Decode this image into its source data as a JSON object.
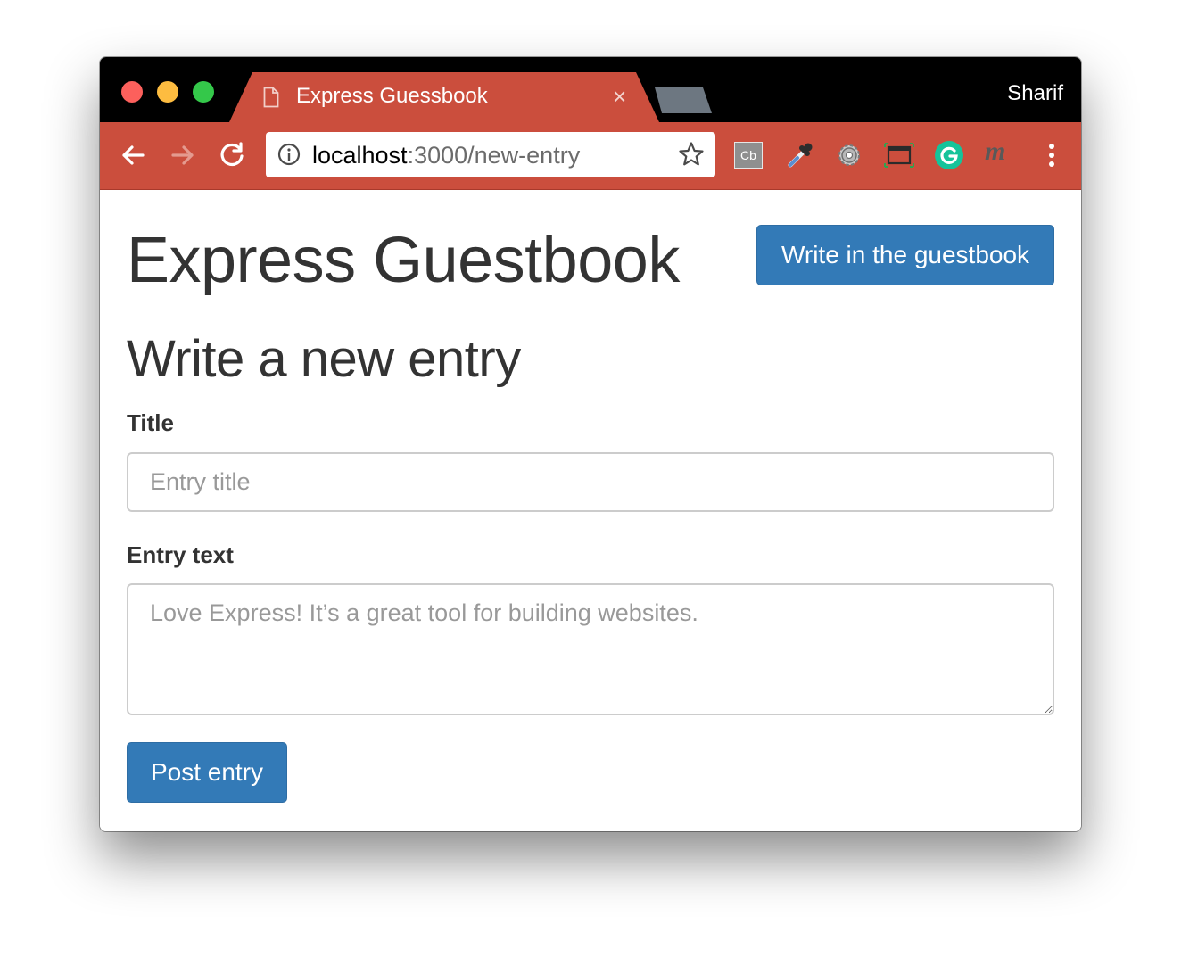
{
  "browser": {
    "tab_title": "Express Guessbook",
    "tab_close": "×",
    "profile_name": "Sharif",
    "url_host": "localhost",
    "url_path": ":3000/new-entry",
    "extensions": {
      "cb_label": "Cb",
      "m_label": "m"
    },
    "colors": {
      "chrome_accent": "#cb4e3d",
      "titlebar": "#000000"
    }
  },
  "page": {
    "site_title": "Express Guestbook",
    "write_button": "Write in the guestbook",
    "heading": "Write a new entry",
    "form": {
      "title_label": "Title",
      "title_placeholder": "Entry title",
      "text_label": "Entry text",
      "text_placeholder": "Love Express! It’s a great tool for building websites.",
      "submit_label": "Post entry"
    },
    "colors": {
      "primary": "#337ab7",
      "text": "#333333"
    }
  }
}
